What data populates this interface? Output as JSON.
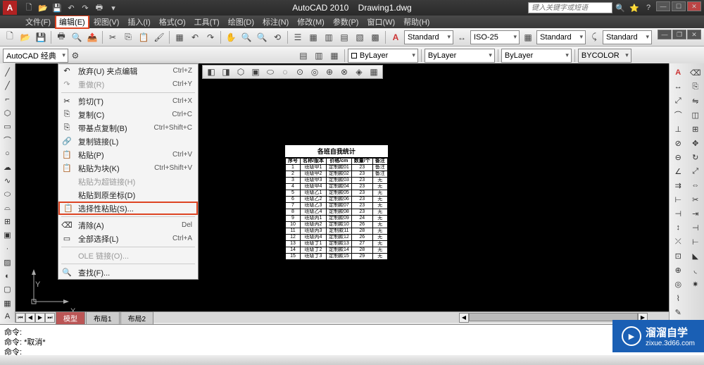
{
  "title": {
    "app": "AutoCAD 2010",
    "doc": "Drawing1.dwg"
  },
  "search_placeholder": "键入关键字或短语",
  "menus": [
    "文件(F)",
    "编辑(E)",
    "视图(V)",
    "插入(I)",
    "格式(O)",
    "工具(T)",
    "绘图(D)",
    "标注(N)",
    "修改(M)",
    "参数(P)",
    "窗口(W)",
    "帮助(H)"
  ],
  "workspace": "AutoCAD 经典",
  "styles": {
    "text": "Standard",
    "dim": "ISO-25",
    "table": "Standard",
    "ml": "Standard"
  },
  "layers": {
    "layer": "ByLayer",
    "linetype": "ByLayer",
    "lineweight": "ByLayer",
    "color": "BYCOLOR"
  },
  "edit_menu": [
    {
      "icon": "↶",
      "label": "放弃(U) 夹点编辑",
      "shortcut": "Ctrl+Z"
    },
    {
      "icon": "↷",
      "label": "重做(R)",
      "shortcut": "Ctrl+Y",
      "disabled": true
    },
    {
      "sep": true
    },
    {
      "icon": "✂",
      "label": "剪切(T)",
      "shortcut": "Ctrl+X"
    },
    {
      "icon": "⎘",
      "label": "复制(C)",
      "shortcut": "Ctrl+C"
    },
    {
      "icon": "⎘",
      "label": "带基点复制(B)",
      "shortcut": "Ctrl+Shift+C"
    },
    {
      "icon": "🔗",
      "label": "复制链接(L)",
      "shortcut": ""
    },
    {
      "icon": "📋",
      "label": "粘贴(P)",
      "shortcut": "Ctrl+V"
    },
    {
      "icon": "📋",
      "label": "粘贴为块(K)",
      "shortcut": "Ctrl+Shift+V"
    },
    {
      "icon": "",
      "label": "粘贴为超链接(H)",
      "shortcut": "",
      "disabled": true
    },
    {
      "icon": "",
      "label": "粘贴到原坐标(D)",
      "shortcut": ""
    },
    {
      "icon": "📋",
      "label": "选择性粘贴(S)...",
      "shortcut": "",
      "highlighted": true
    },
    {
      "sep": true
    },
    {
      "icon": "⌫",
      "label": "清除(A)",
      "shortcut": "Del"
    },
    {
      "icon": "▭",
      "label": "全部选择(L)",
      "shortcut": "Ctrl+A"
    },
    {
      "sep": true
    },
    {
      "icon": "",
      "label": "OLE 链接(O)...",
      "shortcut": "",
      "disabled": true
    },
    {
      "sep": true
    },
    {
      "icon": "🔍",
      "label": "查找(F)...",
      "shortcut": ""
    }
  ],
  "tabs": {
    "active": "模型",
    "others": [
      "布局1",
      "布局2"
    ]
  },
  "cmd": {
    "l1": "命令:",
    "l2": "命令: *取消*",
    "l3": "命令:"
  },
  "ucs": {
    "x": "X",
    "y": "Y"
  },
  "table": {
    "title": "各班自我统计",
    "headers": [
      "序号",
      "名称/版本",
      "价格/cm",
      "数量/个",
      "备注"
    ],
    "rows": [
      [
        "1",
        "班级甲1",
        "定制款01",
        "23",
        "备注"
      ],
      [
        "2",
        "班级甲2",
        "定制款02",
        "23",
        "备注"
      ],
      [
        "3",
        "班级甲3",
        "定制款03",
        "23",
        "无"
      ],
      [
        "4",
        "班级甲4",
        "定制款04",
        "23",
        "无"
      ],
      [
        "5",
        "班级乙1",
        "定制款05",
        "23",
        "无"
      ],
      [
        "6",
        "班级乙2",
        "定制款06",
        "23",
        "无"
      ],
      [
        "7",
        "班级乙3",
        "定制款07",
        "23",
        "无"
      ],
      [
        "8",
        "班级乙4",
        "定制款08",
        "23",
        "无"
      ],
      [
        "9",
        "班级丙1",
        "定制款09",
        "24",
        "无"
      ],
      [
        "10",
        "班级丙2",
        "定制款10",
        "26",
        "无"
      ],
      [
        "11",
        "班级丙3",
        "定制款11",
        "28",
        "无"
      ],
      [
        "12",
        "班级丙4",
        "定制款12",
        "26",
        "无"
      ],
      [
        "13",
        "班级丁1",
        "定制款13",
        "27",
        "无"
      ],
      [
        "14",
        "班级丁2",
        "定制款14",
        "28",
        "无"
      ],
      [
        "15",
        "班级丁3",
        "定制款15",
        "29",
        "无"
      ]
    ]
  },
  "watermark": {
    "title": "溜溜自学",
    "url": "zixue.3d66.com"
  }
}
